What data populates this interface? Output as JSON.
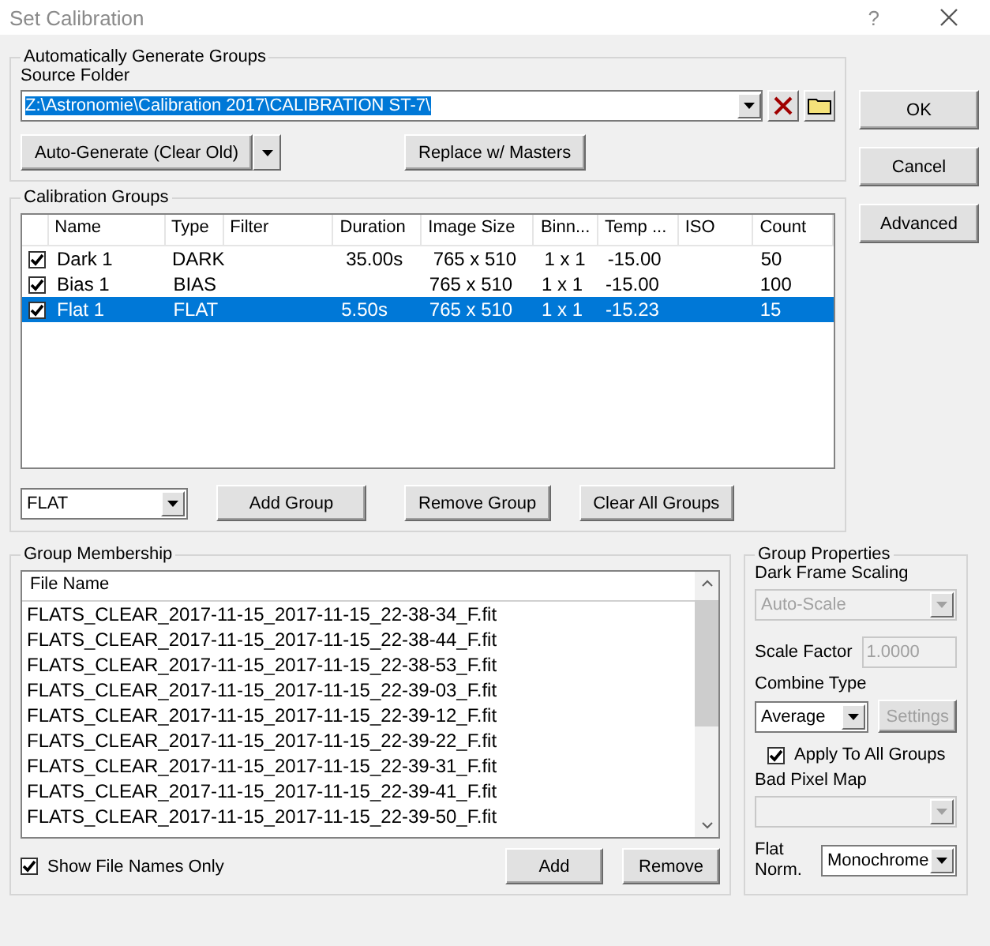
{
  "window": {
    "title": "Set Calibration",
    "help": "?"
  },
  "auto_generate": {
    "title": "Automatically Generate Groups",
    "source_folder_label": "Source Folder",
    "source_folder": "Z:\\Astronomie\\Calibration 2017\\CALIBRATION ST-7\\",
    "auto_generate_button": "Auto-Generate (Clear Old)",
    "replace_button": "Replace w/ Masters"
  },
  "dialog_buttons": [
    "OK",
    "Cancel",
    "Advanced"
  ],
  "calibration_groups": {
    "title": "Calibration Groups",
    "columns": [
      "Name",
      "Type",
      "Filter",
      "Duration",
      "Image Size",
      "Binn...",
      "Temp ...",
      "ISO",
      "Count"
    ],
    "rows": [
      {
        "checked": true,
        "selected": false,
        "cells": [
          "Dark 1",
          "DARK",
          "",
          "35.00s",
          "765 x 510",
          "1 x 1",
          "-15.00",
          "",
          "50"
        ]
      },
      {
        "checked": true,
        "selected": false,
        "cells": [
          "Bias 1",
          "BIAS",
          "",
          "",
          "765 x 510",
          "1 x 1",
          "-15.00",
          "",
          "100"
        ]
      },
      {
        "checked": true,
        "selected": true,
        "cells": [
          "Flat 1",
          "FLAT",
          "",
          "5.50s",
          "765 x 510",
          "1 x 1",
          "-15.23",
          "",
          "15"
        ]
      }
    ],
    "group_type": "FLAT",
    "buttons": [
      "Add Group",
      "Remove Group",
      "Clear All Groups"
    ]
  },
  "group_membership": {
    "title": "Group Membership",
    "column": "File Name",
    "files": [
      "FLATS_CLEAR_2017-11-15_2017-11-15_22-38-34_F.fit",
      "FLATS_CLEAR_2017-11-15_2017-11-15_22-38-44_F.fit",
      "FLATS_CLEAR_2017-11-15_2017-11-15_22-38-53_F.fit",
      "FLATS_CLEAR_2017-11-15_2017-11-15_22-39-03_F.fit",
      "FLATS_CLEAR_2017-11-15_2017-11-15_22-39-12_F.fit",
      "FLATS_CLEAR_2017-11-15_2017-11-15_22-39-22_F.fit",
      "FLATS_CLEAR_2017-11-15_2017-11-15_22-39-31_F.fit",
      "FLATS_CLEAR_2017-11-15_2017-11-15_22-39-41_F.fit",
      "FLATS_CLEAR_2017-11-15_2017-11-15_22-39-50_F.fit"
    ],
    "show_file_names_only": {
      "label": "Show File Names Only",
      "checked": true
    },
    "buttons": [
      "Add",
      "Remove"
    ]
  },
  "group_properties": {
    "title": "Group Properties",
    "dark_frame_scaling": {
      "label": "Dark Frame Scaling",
      "value": "Auto-Scale",
      "disabled": true
    },
    "scale_factor": {
      "label": "Scale Factor",
      "value": "1.0000",
      "disabled": true
    },
    "combine_type": {
      "label": "Combine Type",
      "value": "Average"
    },
    "settings_button": {
      "label": "Settings",
      "disabled": true
    },
    "apply_to_all": {
      "label": "Apply To All Groups",
      "checked": true
    },
    "bad_pixel_map": {
      "label": "Bad Pixel Map",
      "disabled": true
    },
    "flat_norm": {
      "label": "Flat Norm.",
      "value": "Monochrome"
    }
  }
}
